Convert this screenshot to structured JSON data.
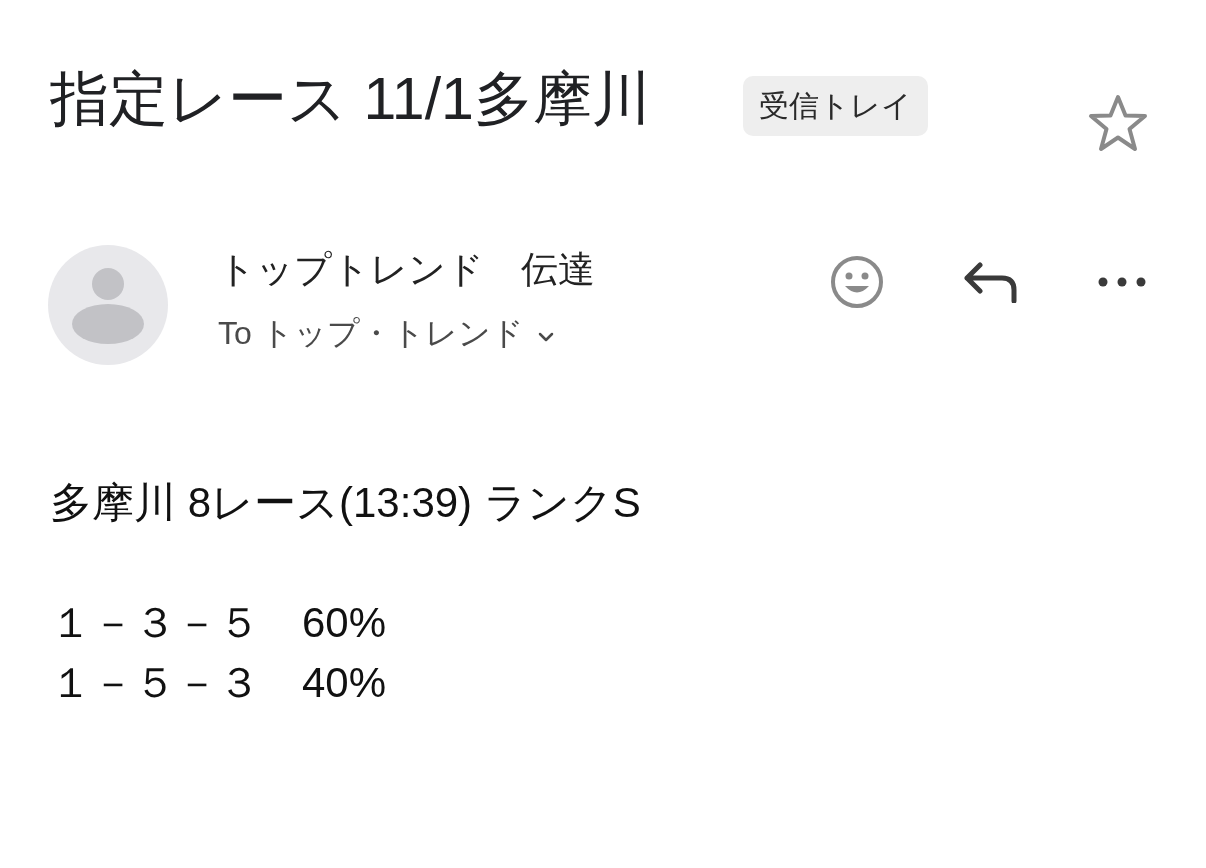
{
  "email": {
    "subject": "指定レース 11/1多摩川",
    "label": "受信トレイ",
    "starred": false
  },
  "sender": {
    "name": "トップトレンド　伝達",
    "recipients": "To トップ・トレンド"
  },
  "body": {
    "paragraphs": [
      {
        "lines": [
          "多摩川 8レース(13:39) ランクS"
        ]
      },
      {
        "lines": [
          "１－３－５　60%",
          "１－５－３　40%"
        ]
      }
    ]
  }
}
